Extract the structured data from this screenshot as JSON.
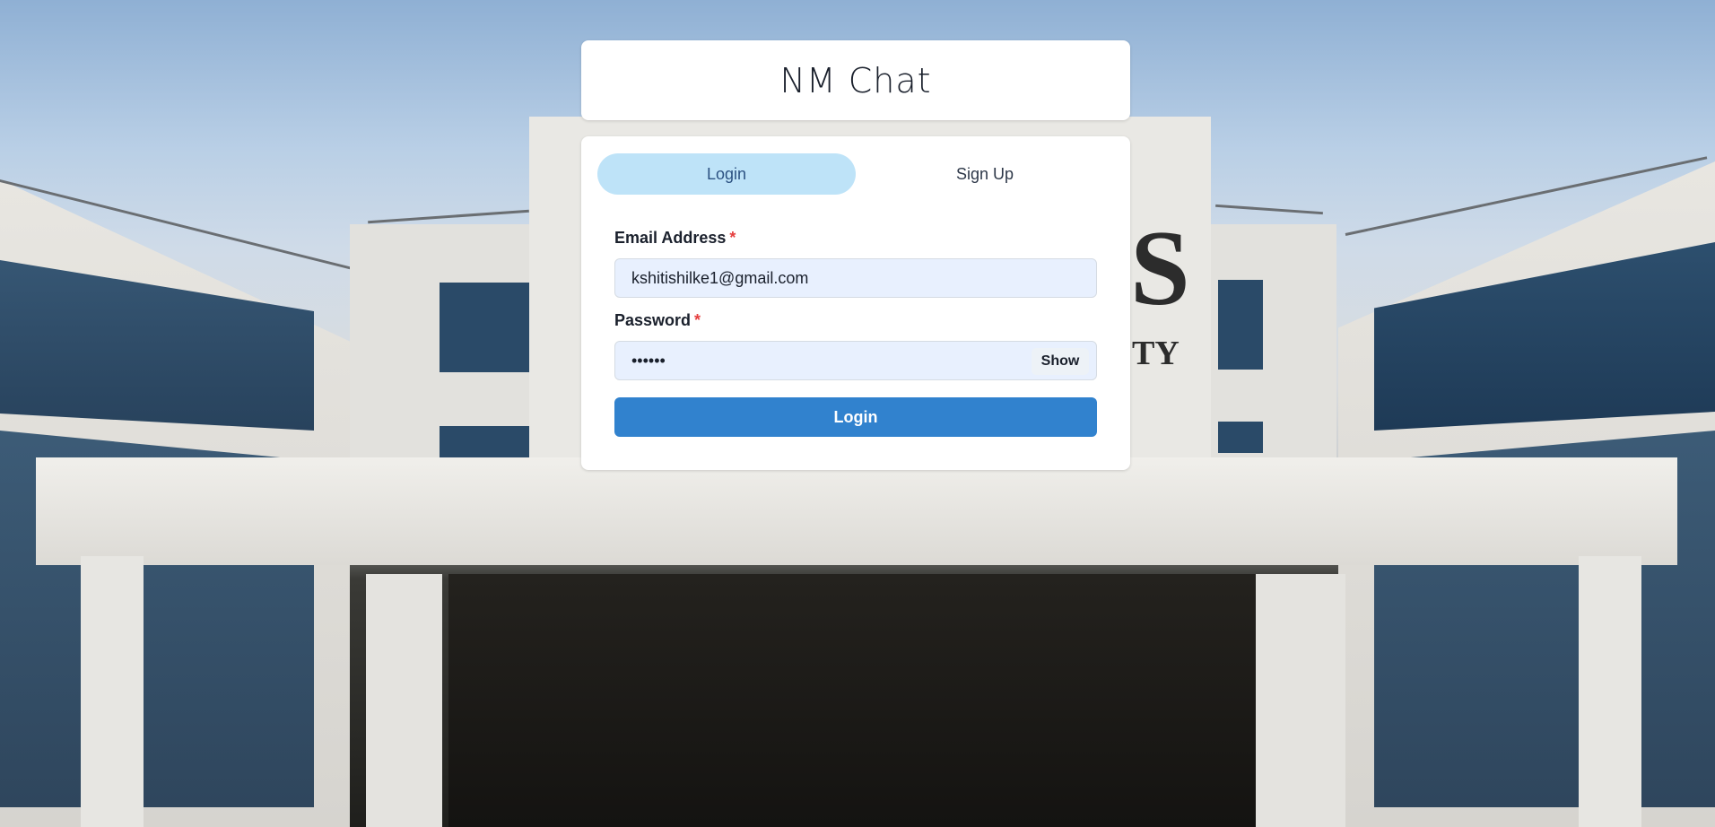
{
  "app": {
    "title": "NM Chat"
  },
  "tabs": [
    {
      "label": "Login",
      "active": true
    },
    {
      "label": "Sign Up",
      "active": false
    }
  ],
  "form": {
    "email": {
      "label": "Email Address",
      "required_marker": "*",
      "value": "kshitishilke1@gmail.com"
    },
    "password": {
      "label": "Password",
      "required_marker": "*",
      "value": "••••••",
      "toggle_label": "Show"
    },
    "submit_label": "Login"
  },
  "background": {
    "logo_fragment_1": "S",
    "logo_fragment_2": "TY"
  },
  "colors": {
    "accent": "#3182ce",
    "tab_active_bg": "#bee3f8",
    "input_bg": "#e8f0fe",
    "required": "#e53e3e"
  }
}
